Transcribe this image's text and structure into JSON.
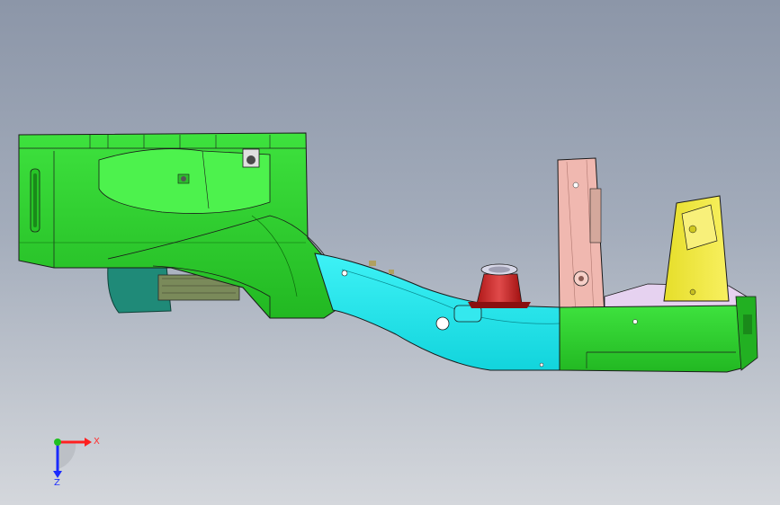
{
  "view": {
    "background_top": "#8c96a8",
    "background_bottom": "#d4d7dc"
  },
  "model": {
    "description_icon": "vehicle-frame-rail-assembly",
    "colors": {
      "green_part": "#2fd42f",
      "green_dark": "#1aa31a",
      "cyan_part": "#1ee8ee",
      "pink_part": "#f0b8b0",
      "yellow_part": "#f0e83a",
      "red_part": "#cc2a2a",
      "teal_part": "#1f8a78",
      "lavender_part": "#e6d2f0",
      "edge_color": "#1a1a1a"
    }
  },
  "triad": {
    "x_label": "X",
    "z_label": "Z",
    "x_color": "#ff2020",
    "z_color": "#1a2aff",
    "y_color": "#20c020"
  }
}
